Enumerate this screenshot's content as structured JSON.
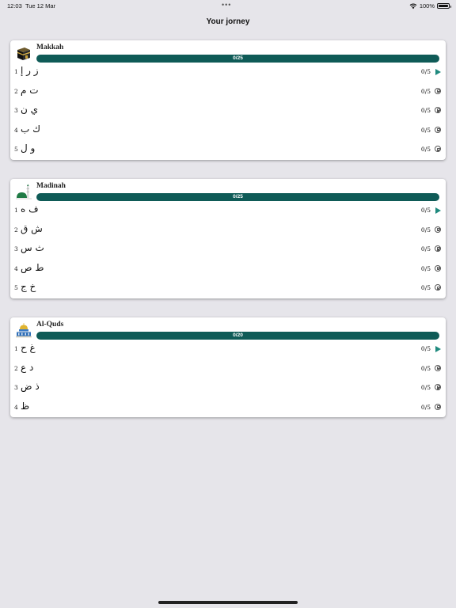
{
  "status_bar": {
    "time": "12:03",
    "date": "Tue 12 Mar",
    "dots": "•••",
    "battery": "100%",
    "wifi_icon": "wifi-icon",
    "battery_icon": "battery-icon"
  },
  "title": "Your jorney",
  "colors": {
    "progress_bar": "#0f5b57",
    "accent": "#1f8a7e",
    "background": "#e6e5ea"
  },
  "cities": [
    {
      "name": "Makkah",
      "icon": "kaaba-icon",
      "progress_text": "0/25",
      "progress": 0,
      "lessons": [
        {
          "number": "1",
          "letters": "ز ر إ",
          "score": "0/5",
          "state": "play"
        },
        {
          "number": "2",
          "letters": "ت م",
          "score": "0/5",
          "state": "locked"
        },
        {
          "number": "3",
          "letters": "ي ن",
          "score": "0/5",
          "state": "locked"
        },
        {
          "number": "4",
          "letters": "ك ب",
          "score": "0/5",
          "state": "locked"
        },
        {
          "number": "5",
          "letters": "و ل",
          "score": "0/5",
          "state": "locked"
        }
      ]
    },
    {
      "name": "Madinah",
      "icon": "mosque-icon",
      "progress_text": "0/25",
      "progress": 0,
      "lessons": [
        {
          "number": "1",
          "letters": "ف ه",
          "score": "0/5",
          "state": "play"
        },
        {
          "number": "2",
          "letters": "ش ق",
          "score": "0/5",
          "state": "locked"
        },
        {
          "number": "3",
          "letters": "ث س",
          "score": "0/5",
          "state": "locked"
        },
        {
          "number": "4",
          "letters": "ط ص",
          "score": "0/5",
          "state": "locked"
        },
        {
          "number": "5",
          "letters": "خ ج",
          "score": "0/5",
          "state": "locked"
        }
      ]
    },
    {
      "name": "Al-Quds",
      "icon": "dome-of-the-rock-icon",
      "progress_text": "0/20",
      "progress": 0,
      "lessons": [
        {
          "number": "1",
          "letters": "غ ح",
          "score": "0/5",
          "state": "play"
        },
        {
          "number": "2",
          "letters": "د ع",
          "score": "0/5",
          "state": "locked"
        },
        {
          "number": "3",
          "letters": "ذ ض",
          "score": "0/5",
          "state": "locked"
        },
        {
          "number": "4",
          "letters": "ظ",
          "score": "0/5",
          "state": "locked"
        }
      ]
    }
  ]
}
